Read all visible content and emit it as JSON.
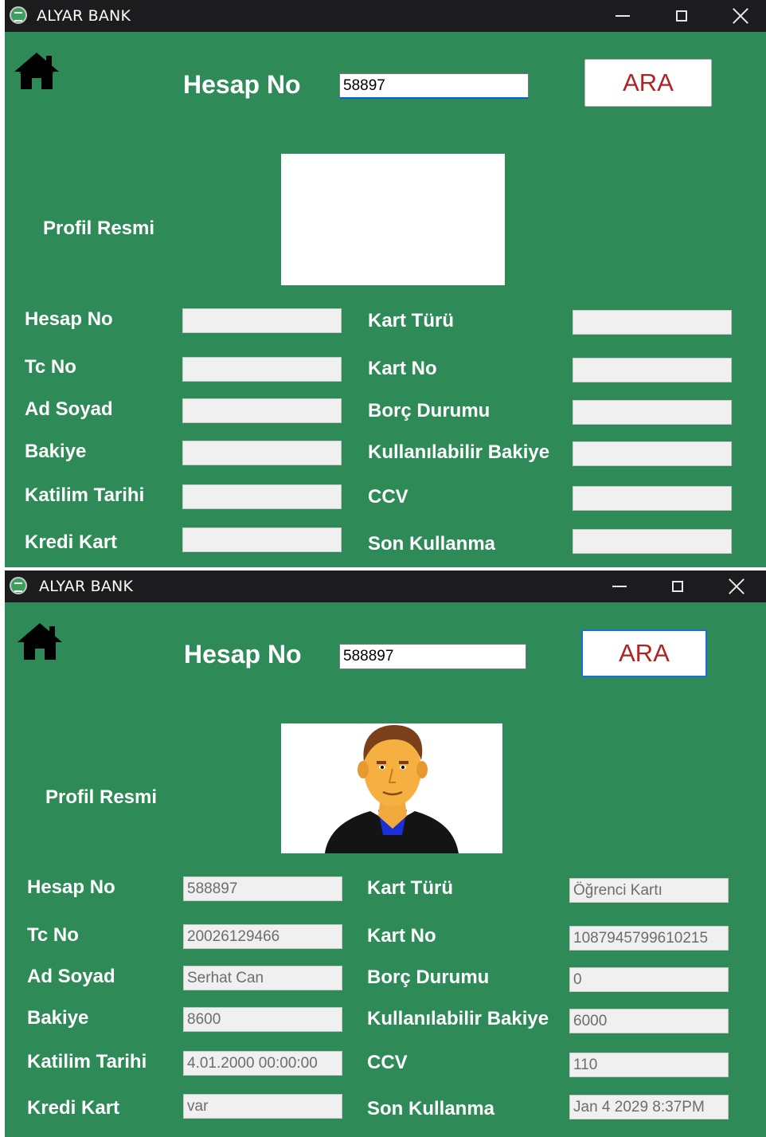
{
  "app_title": "ALYAR BANK",
  "screens": [
    {
      "search": {
        "label": "Hesap No",
        "value": "58897",
        "button": "ARA"
      },
      "profile_label": "Profil Resmi",
      "left_fields": [
        {
          "label": "Hesap No",
          "value": ""
        },
        {
          "label": "Tc No",
          "value": ""
        },
        {
          "label": "Ad Soyad",
          "value": ""
        },
        {
          "label": "Bakiye",
          "value": ""
        },
        {
          "label": "Katilim Tarihi",
          "value": ""
        },
        {
          "label": "Kredi Kart",
          "value": ""
        }
      ],
      "right_fields": [
        {
          "label": "Kart Türü",
          "value": ""
        },
        {
          "label": "Kart No",
          "value": ""
        },
        {
          "label": "Borç Durumu",
          "value": ""
        },
        {
          "label": "Kullanılabilir Bakiye",
          "value": ""
        },
        {
          "label": "CCV",
          "value": ""
        },
        {
          "label": "Son Kullanma",
          "value": ""
        }
      ]
    },
    {
      "search": {
        "label": "Hesap No",
        "value": "588897",
        "button": "ARA"
      },
      "profile_label": "Profil Resmi",
      "left_fields": [
        {
          "label": "Hesap No",
          "value": "588897"
        },
        {
          "label": "Tc No",
          "value": "20026129466"
        },
        {
          "label": "Ad Soyad",
          "value": "Serhat Can"
        },
        {
          "label": "Bakiye",
          "value": "8600"
        },
        {
          "label": "Katilim Tarihi",
          "value": "4.01.2000 00:00:00"
        },
        {
          "label": "Kredi Kart",
          "value": "var"
        }
      ],
      "right_fields": [
        {
          "label": "Kart Türü",
          "value": "Öğrenci Kartı"
        },
        {
          "label": "Kart No",
          "value": "1087945799610215"
        },
        {
          "label": "Borç Durumu",
          "value": "0"
        },
        {
          "label": "Kullanılabilir Bakiye",
          "value": "6000"
        },
        {
          "label": "CCV",
          "value": "110"
        },
        {
          "label": "Son Kullanma",
          "value": "Jan  4 2029  8:37PM"
        }
      ]
    }
  ],
  "colors": {
    "background": "#2e8b57",
    "titlebar": "#1c1c1f",
    "button_text": "#b22222"
  }
}
